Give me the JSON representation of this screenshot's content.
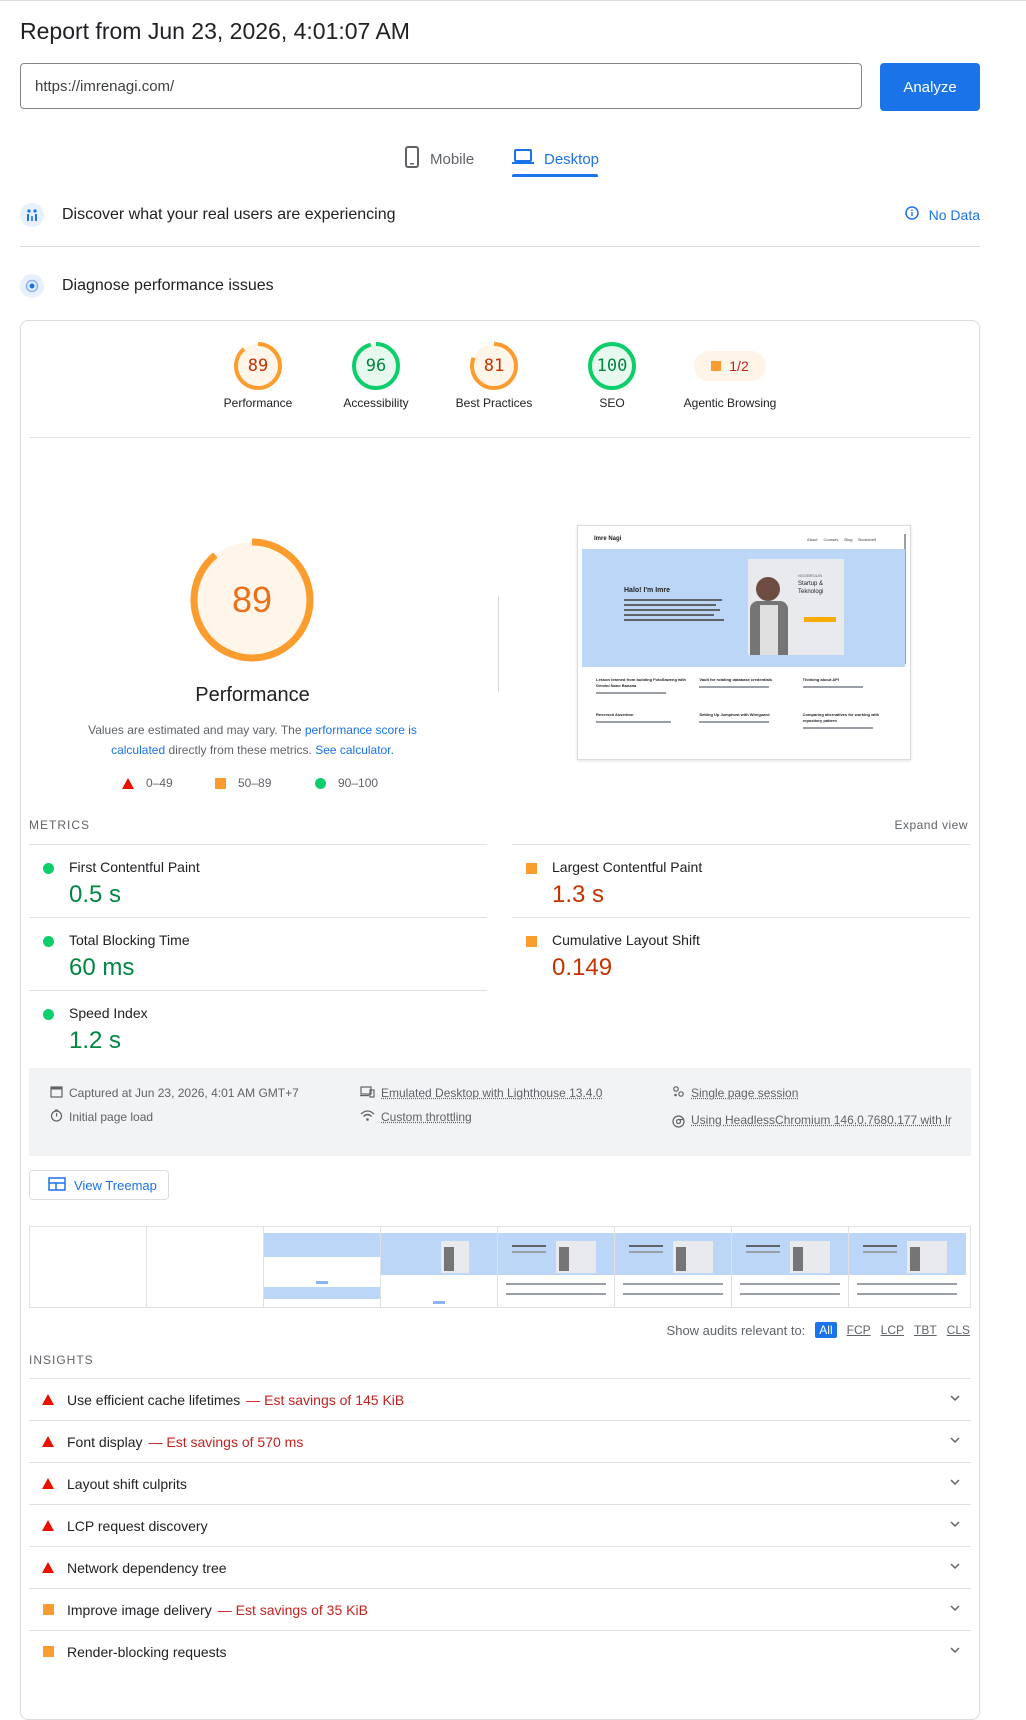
{
  "header": {
    "title": "Report from Jun 23, 2026, 4:01:07 AM",
    "url_value": "https://imrenagi.com/",
    "analyze_label": "Analyze"
  },
  "tabs": [
    {
      "label": "Mobile",
      "icon": "phone-icon",
      "active": false
    },
    {
      "label": "Desktop",
      "icon": "laptop-icon",
      "active": true
    }
  ],
  "crux": {
    "title": "Discover what your real users are experiencing",
    "status": "No Data"
  },
  "diagnose": {
    "title": "Diagnose performance issues"
  },
  "categories": [
    {
      "name": "Performance",
      "score": "89",
      "level": 0.89,
      "color": "#fa9d2e",
      "text_color": "#c33300"
    },
    {
      "name": "Accessibility",
      "score": "96",
      "level": 0.96,
      "color": "#0cce6b",
      "text_color": "#018642"
    },
    {
      "name": "Best Practices",
      "score": "81",
      "level": 0.81,
      "color": "#fa9d2e",
      "text_color": "#c33300"
    },
    {
      "name": "SEO",
      "score": "100",
      "level": 1.0,
      "color": "#0cce6b",
      "text_color": "#018642"
    },
    {
      "name": "Agentic Browsing",
      "score": "1/2"
    }
  ],
  "performance": {
    "score": "89",
    "level": 0.89,
    "title": "Performance",
    "note_pre": "Values are estimated and may vary. The ",
    "note_link1": "performance score is calculated",
    "note_mid": " directly from these metrics. ",
    "note_link2": "See calculator.",
    "legend": [
      "0–49",
      "50–89",
      "90–100"
    ]
  },
  "screenshot": {
    "site_name": "Imre Nagi",
    "nav": [
      "About",
      "Courses",
      "Blog",
      "Bookshelf"
    ],
    "hero_title": "Halo! I'm Imre",
    "badge_line1": "NGOBROLIN",
    "badge_line2": "Startup &",
    "badge_line3": "Teknologi",
    "posts": [
      "Lesson learned from building FotoSaweng with Gemini Nano Banana",
      "Vault for rotating database credentials",
      "Thinking about API",
      "Reversed Assertion",
      "Setting Up Jumphost with Wireguard",
      "Comparing alternatives for working with repository pattern"
    ]
  },
  "metrics": {
    "section_label": "METRICS",
    "expand_label": "Expand view",
    "items": [
      {
        "name": "First Contentful Paint",
        "value": "0.5 s",
        "rating": "pass"
      },
      {
        "name": "Largest Contentful Paint",
        "value": "1.3 s",
        "rating": "average"
      },
      {
        "name": "Total Blocking Time",
        "value": "60 ms",
        "rating": "pass"
      },
      {
        "name": "Cumulative Layout Shift",
        "value": "0.149",
        "rating": "average"
      },
      {
        "name": "Speed Index",
        "value": "1.2 s",
        "rating": "pass"
      }
    ]
  },
  "runinfo": {
    "captured": "Captured at Jun 23, 2026, 4:01 AM GMT+7",
    "initial_load": "Initial page load",
    "emulated": "Emulated Desktop with Lighthouse 13.4.0",
    "throttling": "Custom throttling",
    "session": "Single page session",
    "browser": "Using HeadlessChromium 146.0.7680.177 with lr"
  },
  "treemap_label": "View Treemap",
  "audit_filter": {
    "label": "Show audits relevant to:",
    "options": [
      "All",
      "FCP",
      "LCP",
      "TBT",
      "CLS"
    ]
  },
  "insights": {
    "section_label": "INSIGHTS",
    "items": [
      {
        "title": "Use efficient cache lifetimes",
        "savings": "— Est savings of 145 KiB",
        "rating": "fail"
      },
      {
        "title": "Font display",
        "savings": "— Est savings of 570 ms",
        "rating": "fail"
      },
      {
        "title": "Layout shift culprits",
        "savings": "",
        "rating": "fail"
      },
      {
        "title": "LCP request discovery",
        "savings": "",
        "rating": "fail"
      },
      {
        "title": "Network dependency tree",
        "savings": "",
        "rating": "fail"
      },
      {
        "title": "Improve image delivery",
        "savings": "— Est savings of 35 KiB",
        "rating": "average"
      },
      {
        "title": "Render-blocking requests",
        "savings": "",
        "rating": "average"
      }
    ]
  }
}
